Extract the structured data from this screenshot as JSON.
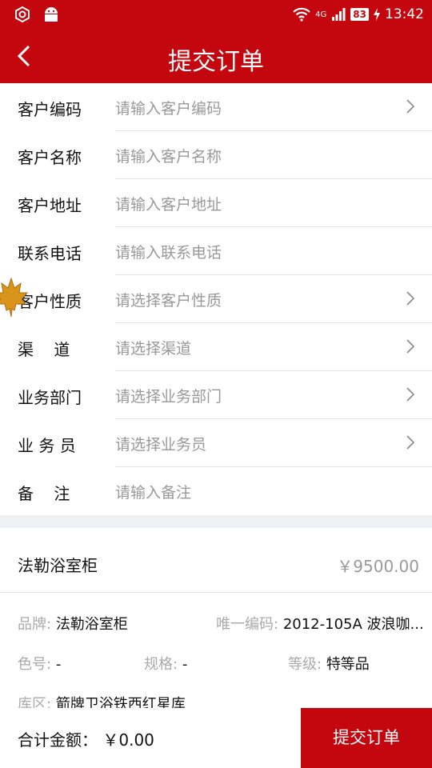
{
  "status_bar": {
    "network": "4G",
    "battery": "83",
    "time": "13:42"
  },
  "header": {
    "title": "提交订单"
  },
  "form": {
    "rows": [
      {
        "label": "客户编码",
        "placeholder": "请输入客户编码",
        "chevron": true
      },
      {
        "label": "客户名称",
        "placeholder": "请输入客户名称",
        "chevron": false
      },
      {
        "label": "客户地址",
        "placeholder": "请输入客户地址",
        "chevron": false
      },
      {
        "label": "联系电话",
        "placeholder": "请输入联系电话",
        "chevron": false
      },
      {
        "label": "客户性质",
        "placeholder": "请选择客户性质",
        "chevron": true
      },
      {
        "label": "渠    道",
        "placeholder": "请选择渠道",
        "chevron": true
      },
      {
        "label": "业务部门",
        "placeholder": "请选择业务部门",
        "chevron": true
      },
      {
        "label": "业 务 员",
        "placeholder": "请选择业务员",
        "chevron": true
      },
      {
        "label": "备    注",
        "placeholder": "请输入备注",
        "chevron": false
      }
    ]
  },
  "product": {
    "name": "法勒浴室柜",
    "price": "￥9500.00",
    "brand_label": "品牌:",
    "brand_value": "法勒浴室柜",
    "code_label": "唯一编码:",
    "code_value": "2012-105A 波浪咖...",
    "color_label": "色号:",
    "color_value": "-",
    "spec_label": "规格:",
    "spec_value": "-",
    "grade_label": "等级:",
    "grade_value": "特等品",
    "warehouse_label": "库区:",
    "warehouse_value": "箭牌卫浴铁西红星库"
  },
  "footer": {
    "total_label": "合计金额：",
    "total_value": "￥0.00",
    "submit_label": "提交订单"
  },
  "colors": {
    "brand_red": "#c4060f",
    "placeholder": "#999999",
    "divider": "#e6e6e6"
  }
}
